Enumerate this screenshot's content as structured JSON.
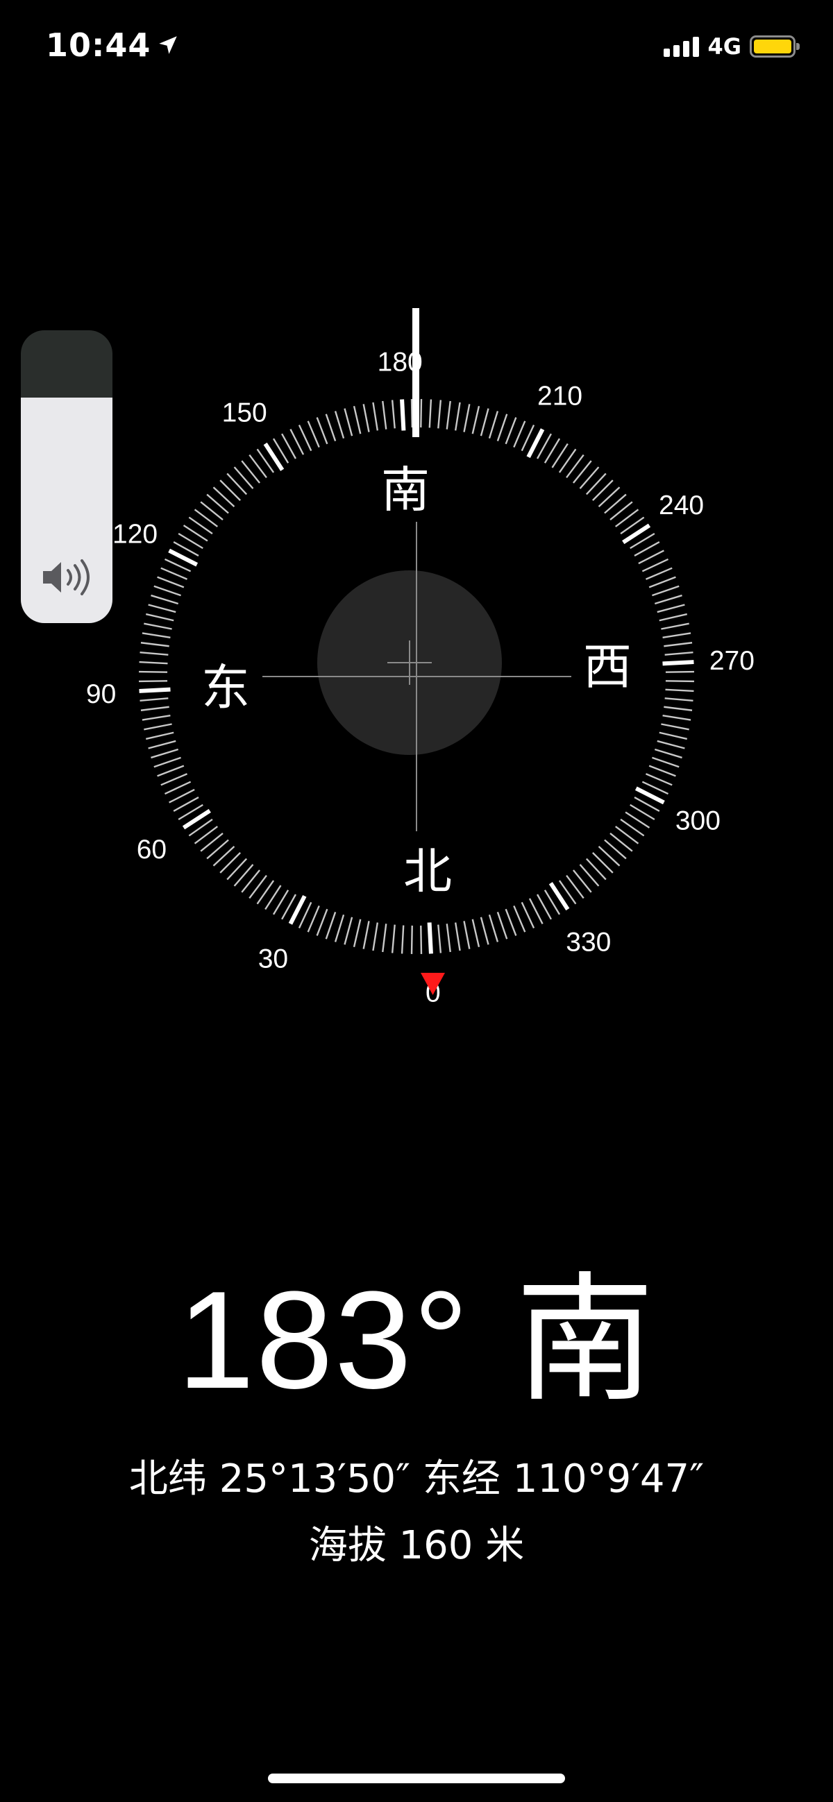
{
  "status_bar": {
    "time": "10:44",
    "network": "4G",
    "signal_bars": 4,
    "battery_color": "#ffd60a",
    "location_icon": "location-arrow-icon"
  },
  "compass": {
    "heading_degrees": 183,
    "dial_numbers": [
      "0",
      "30",
      "60",
      "90",
      "120",
      "150",
      "180",
      "210",
      "240",
      "270",
      "300",
      "330"
    ],
    "cardinals": {
      "north": "北",
      "south": "南",
      "east": "东",
      "west": "西"
    },
    "north_marker_color": "#ff1a1a"
  },
  "volume_hud": {
    "level": 0.77,
    "icon": "speaker-icon"
  },
  "readout": {
    "heading": "183°",
    "direction": "南",
    "coordinates": "北纬 25°13′50″  东经 110°9′47″",
    "elevation": "海拔 160 米"
  }
}
